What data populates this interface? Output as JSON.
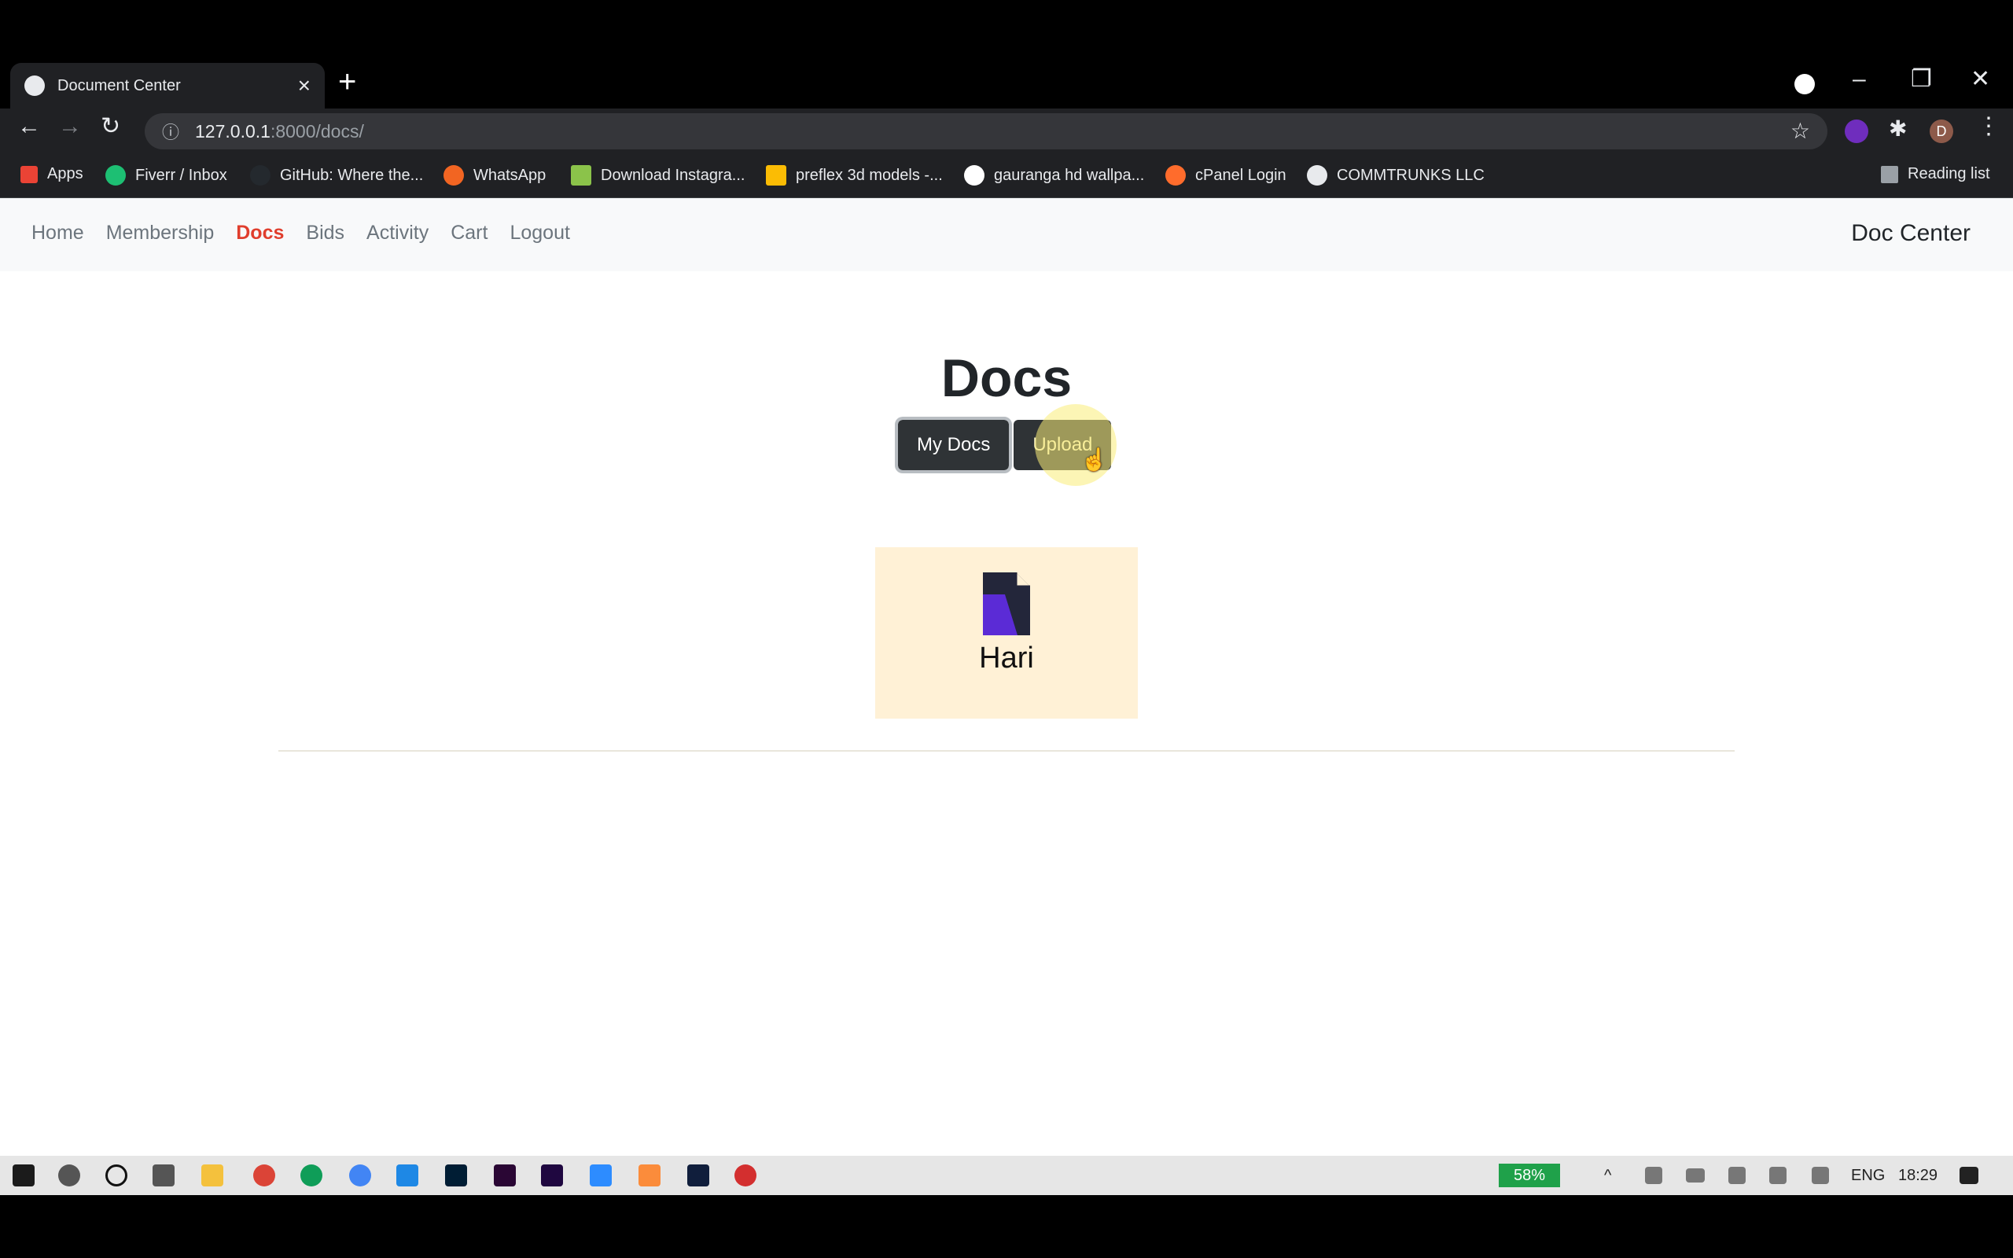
{
  "browser": {
    "tab_title": "Document Center",
    "url_host": "127.0.0.1",
    "url_path": ":8000/docs/",
    "bookmarks": [
      "Apps",
      "Fiverr / Inbox",
      "GitHub: Where the...",
      "WhatsApp",
      "Download Instagra...",
      "preflex 3d models -...",
      "gauranga hd wallpa...",
      "cPanel Login",
      "COMMTRUNKS LLC"
    ],
    "reading_list": "Reading list",
    "profile_initial": "D"
  },
  "navbar": {
    "links": [
      "Home",
      "Membership",
      "Docs",
      "Bids",
      "Activity",
      "Cart",
      "Logout"
    ],
    "active": "Docs",
    "brand": "Doc Center"
  },
  "main": {
    "heading": "Docs",
    "my_docs_button": "My Docs",
    "upload_button": "Upload",
    "documents": [
      {
        "name": "Hari"
      }
    ]
  },
  "taskbar": {
    "battery": "58%",
    "language": "ENG",
    "time": "18:29"
  },
  "colors": {
    "active_link": "#e03e2d",
    "button_bg": "#2f3336",
    "card_bg": "#fff1d6"
  }
}
